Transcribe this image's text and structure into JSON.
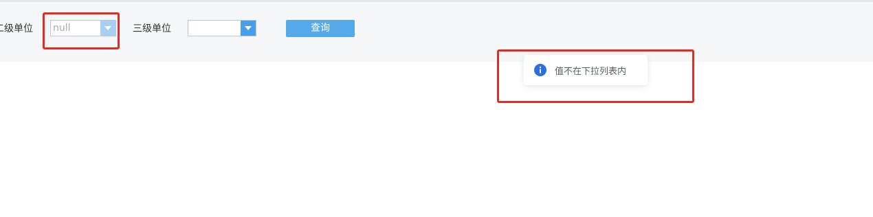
{
  "filters": {
    "level2": {
      "label": "二级单位",
      "value": "null"
    },
    "level3": {
      "label": "三级单位",
      "value": ""
    },
    "query_label": "查询"
  },
  "toast": {
    "icon": "info-icon",
    "message": "值不在下拉列表内",
    "icon_color": "#2b6fe0"
  },
  "colors": {
    "annotation_box": "#e42a22",
    "query_button": "#56aaeb"
  }
}
